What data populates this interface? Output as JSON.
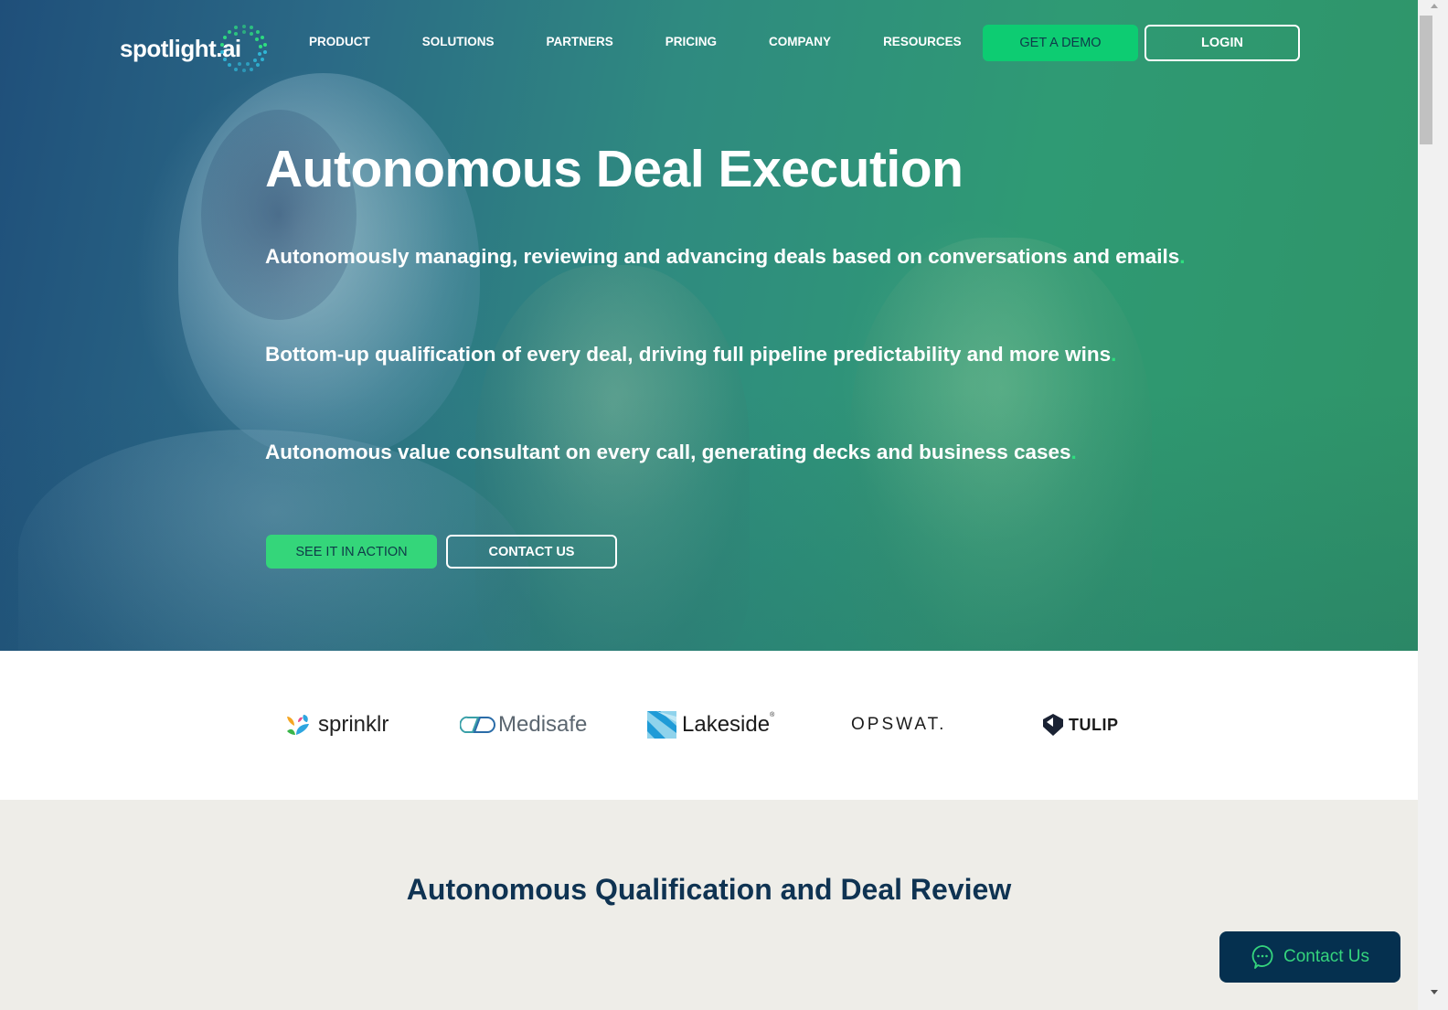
{
  "brand": {
    "logo_text": "spotlight.ai",
    "accent_green": "#0dcc72",
    "navy": "#05304f"
  },
  "nav": {
    "items": [
      {
        "label": "PRODUCT"
      },
      {
        "label": "SOLUTIONS"
      },
      {
        "label": "PARTNERS"
      },
      {
        "label": "PRICING"
      },
      {
        "label": "COMPANY"
      },
      {
        "label": "RESOURCES"
      }
    ],
    "demo_label": "GET A DEMO",
    "login_label": "LOGIN"
  },
  "hero": {
    "title": "Autonomous Deal Execution",
    "lines": [
      {
        "text": "Autonomously managing, reviewing and advancing deals based on conversations and emails",
        "dot": "."
      },
      {
        "text": "Bottom-up qualification of every deal, driving full pipeline predictability and more wins",
        "dot": "."
      },
      {
        "text": "Autonomous value consultant on every call, generating decks and business cases",
        "dot": "."
      }
    ],
    "primary_cta": "SEE IT IN ACTION",
    "secondary_cta": "CONTACT US"
  },
  "customers": {
    "logos": [
      {
        "name": "sprinklr"
      },
      {
        "name": "Medisafe"
      },
      {
        "name": "Lakeside",
        "mark": "®"
      },
      {
        "name": "OPSWAT."
      },
      {
        "name": "TULIP"
      }
    ]
  },
  "section": {
    "title": "Autonomous Qualification and Deal Review"
  },
  "floating_contact": {
    "label": "Contact Us",
    "icon": "chat-bubble-icon"
  }
}
